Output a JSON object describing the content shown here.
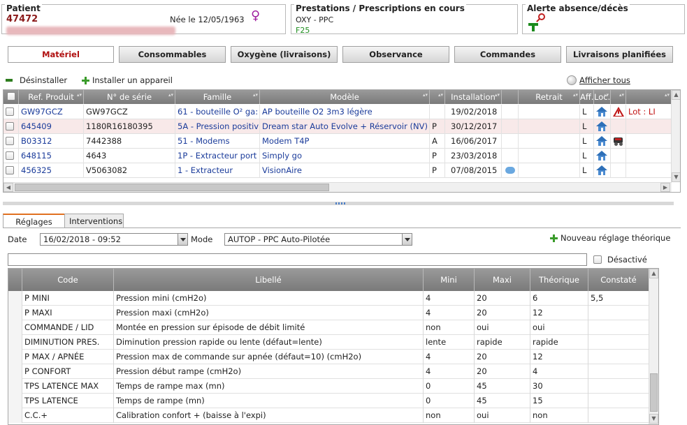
{
  "header": {
    "patient": {
      "title": "Patient",
      "id": "47472",
      "born": "Née le 12/05/1963"
    },
    "prescriptions": {
      "title": "Prestations / Prescriptions en cours",
      "line1": "OXY - PPC",
      "line2": "F25"
    },
    "alert": {
      "title": "Alerte absence/décès"
    }
  },
  "tabs": [
    "Matériel",
    "Consommables",
    "Oxygène (livraisons)",
    "Observance",
    "Commandes",
    "Livraisons planifiées"
  ],
  "toolbar": {
    "uninstall": "Désinstaller",
    "install": "Installer un appareil",
    "show_all": "Afficher tous"
  },
  "equipment_grid": {
    "columns": [
      "Ref. Produit",
      "N° de série",
      "Famille",
      "Modèle",
      "Installation",
      "Retrait",
      "Aff.",
      "Loc."
    ],
    "rows": [
      {
        "ref": "GW97GCZ",
        "serial": "GW97GCZ",
        "family": "61 - bouteille O² ga:",
        "model": "AP bouteille O2 3m3 légère",
        "flag": "",
        "install": "19/02/2018",
        "aff": "L",
        "lot": "Lot : LI"
      },
      {
        "ref": "645409",
        "serial": "1180R16180395",
        "family": "5A - Pression positiv",
        "model": "Dream star Auto Evolve + Réservoir (NV)",
        "flag": "P",
        "install": "30/12/2017",
        "aff": "L",
        "lot": ""
      },
      {
        "ref": "B03312",
        "serial": "7442388",
        "family": "51 - Modems",
        "model": "Modem T4P",
        "flag": "A",
        "install": "16/06/2017",
        "aff": "L",
        "lot": ""
      },
      {
        "ref": "648115",
        "serial": "4643",
        "family": "1P - Extracteur port",
        "model": "Simply go",
        "flag": "P",
        "install": "23/03/2018",
        "aff": "L",
        "lot": ""
      },
      {
        "ref": "456325",
        "serial": "V5063082",
        "family": "1 - Extracteur",
        "model": "VisionAire",
        "flag": "P",
        "install": "07/08/2015",
        "aff": "L",
        "lot": ""
      }
    ]
  },
  "bottom_tabs": [
    "Réglages",
    "Interventions"
  ],
  "settings": {
    "date_label": "Date",
    "date_value": "16/02/2018 - 09:52",
    "mode_label": "Mode",
    "mode_value": "AUTOP - PPC Auto-Pilotée",
    "new_setting": "Nouveau réglage théorique",
    "filter_value": "",
    "disabled_label": "Désactivé",
    "columns": [
      "Code",
      "Libellé",
      "Mini",
      "Maxi",
      "Théorique",
      "Constaté"
    ],
    "rows": [
      {
        "code": "P MINI",
        "label": "Pression mini (cmH2o)",
        "min": "4",
        "max": "20",
        "theo": "6",
        "obs": "5,5"
      },
      {
        "code": "P MAXI",
        "label": "Pression maxi (cmH2o)",
        "min": "4",
        "max": "20",
        "theo": "12",
        "obs": ""
      },
      {
        "code": "COMMANDE / LID",
        "label": "Montée en pression sur épisode de débit limité",
        "min": "non",
        "max": "oui",
        "theo": "oui",
        "obs": ""
      },
      {
        "code": "DIMINUTION PRES.",
        "label": "Diminution pression rapide ou lente (défaut=lente)",
        "min": "lente",
        "max": "rapide",
        "theo": "rapide",
        "obs": ""
      },
      {
        "code": "P MAX / APNÉE",
        "label": "Pression max de commande sur apnée (défaut=10) (cmH2o)",
        "min": "4",
        "max": "20",
        "theo": "12",
        "obs": ""
      },
      {
        "code": "P CONFORT",
        "label": "Pression début rampe (cmH2o)",
        "min": "4",
        "max": "20",
        "theo": "4",
        "obs": ""
      },
      {
        "code": "TPS LATENCE MAX",
        "label": "Temps de rampe max (mn)",
        "min": "0",
        "max": "45",
        "theo": "30",
        "obs": ""
      },
      {
        "code": "TPS LATENCE",
        "label": "Temps de rampe (mn)",
        "min": "0",
        "max": "45",
        "theo": "15",
        "obs": ""
      },
      {
        "code": "C.C.+",
        "label": "Calibration confort + (baisse à l'expi)",
        "min": "non",
        "max": "oui",
        "theo": "non",
        "obs": ""
      }
    ]
  },
  "colors": {
    "patient_id": "#8b1a1a",
    "active_tab": "#b01010",
    "link_blue": "#1a3b9a",
    "prescription_code": "#1e8e1e",
    "grid_header": "#8a8a8a"
  },
  "icons": [
    "female-icon",
    "alert-person-icon",
    "minus-icon",
    "plus-icon",
    "globe-icon",
    "house-icon",
    "warning-icon",
    "truck-icon",
    "comment-icon"
  ]
}
